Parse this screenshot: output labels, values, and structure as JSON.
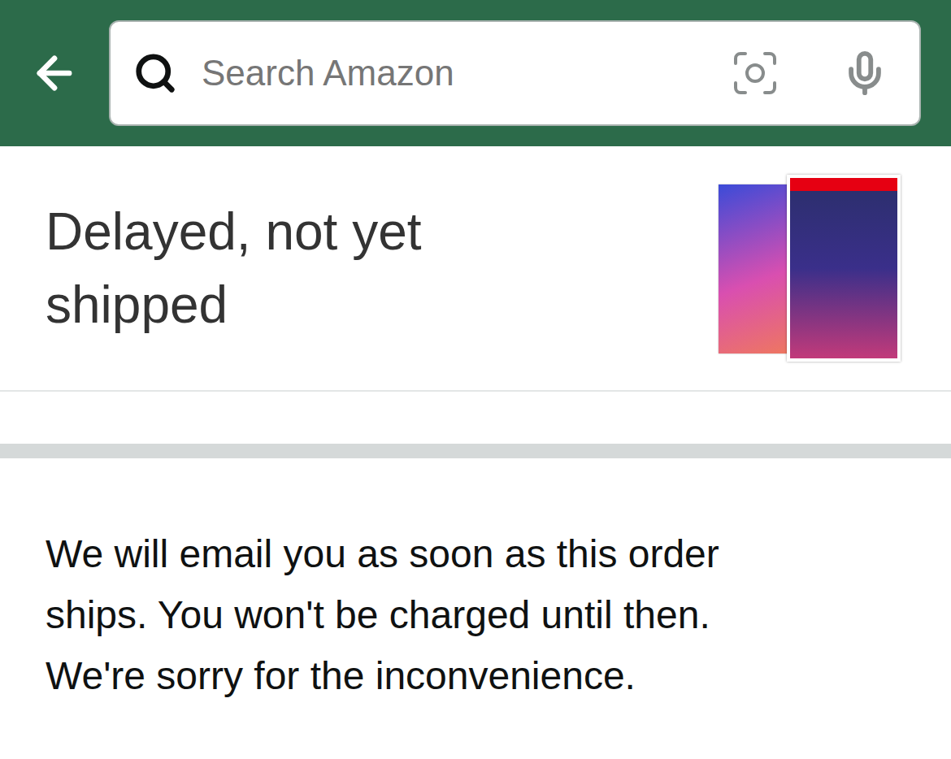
{
  "header": {
    "search": {
      "placeholder": "Search Amazon"
    }
  },
  "order": {
    "status": [
      "Delayed, not yet",
      "shipped"
    ]
  },
  "message": [
    "We will email you as soon as this order",
    "ships. You won't be charged until then.",
    "We're sorry for the inconvenience."
  ]
}
